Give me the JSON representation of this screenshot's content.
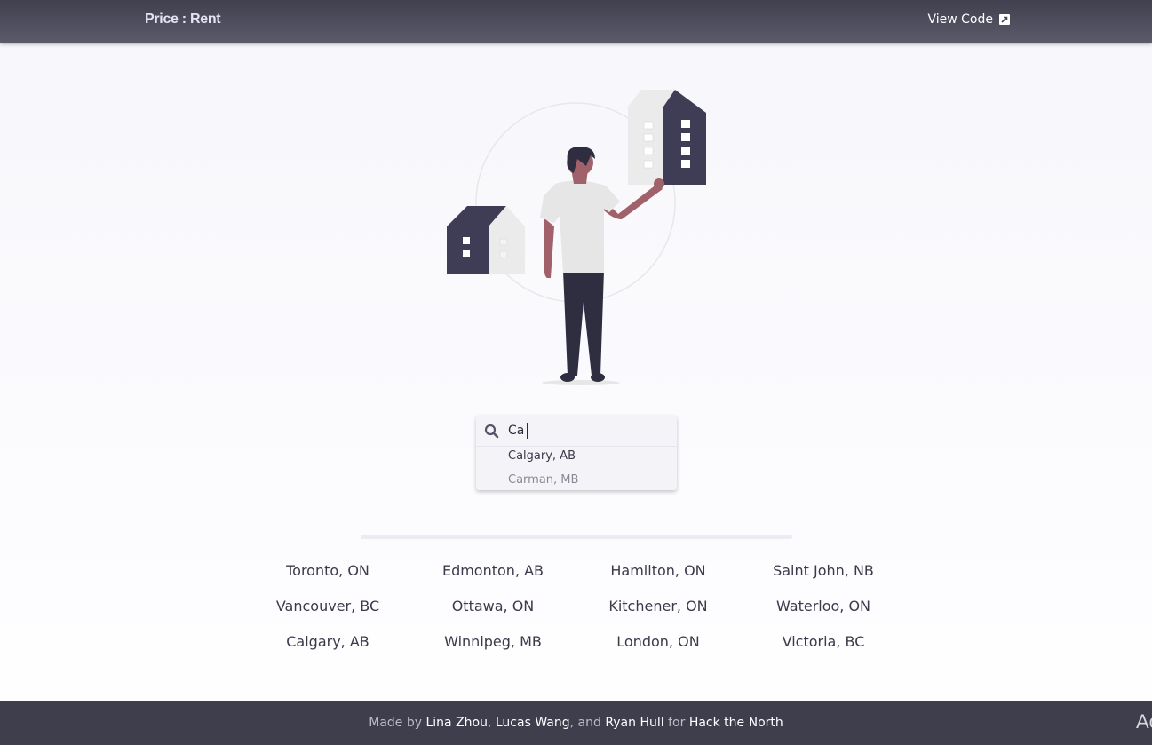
{
  "header": {
    "brand": "Price : Rent",
    "view_code_label": "View Code",
    "view_code_icon": "external-link-icon"
  },
  "search": {
    "value": "Ca",
    "icon": "search-icon",
    "suggestions": [
      "Calgary, AB",
      "Carman, MB"
    ]
  },
  "cities": [
    "Toronto, ON",
    "Edmonton, AB",
    "Hamilton, ON",
    "Saint John, NB",
    "Vancouver, BC",
    "Ottawa, ON",
    "Kitchener, ON",
    "Waterloo, ON",
    "Calgary, AB",
    "Winnipeg, MB",
    "London, ON",
    "Victoria, BC"
  ],
  "footer": {
    "made_by": "Made by",
    "author1": "Lina Zhou",
    "sep1": ",",
    "author2": "Lucas Wang",
    "sep2": ", and",
    "author3": "Ryan Hull",
    "for": "for",
    "event": "Hack the North"
  },
  "watermark": "Ac",
  "colors": {
    "header_bg": "#4a4958",
    "footer_bg": "#3f3e4d",
    "illustration_dark": "#3f3d56",
    "skin": "#a0616a"
  }
}
